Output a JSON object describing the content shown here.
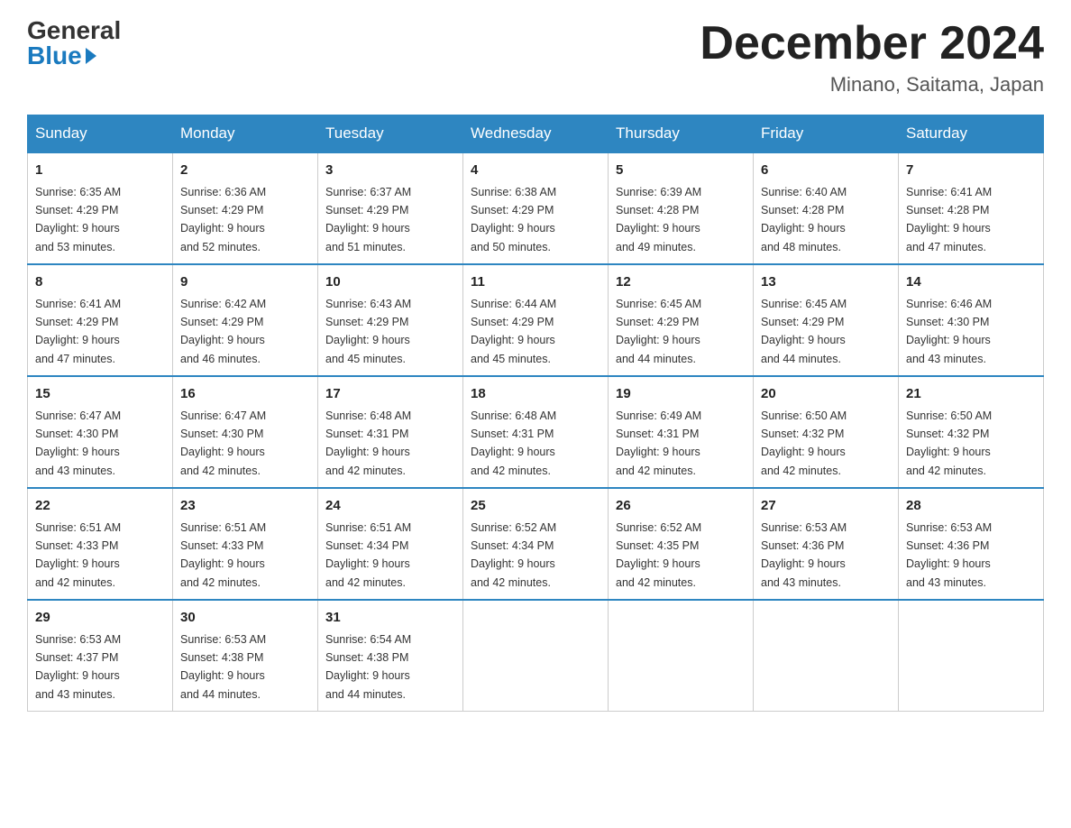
{
  "header": {
    "logo_general": "General",
    "logo_blue": "Blue",
    "month_title": "December 2024",
    "location": "Minano, Saitama, Japan"
  },
  "days_of_week": [
    "Sunday",
    "Monday",
    "Tuesday",
    "Wednesday",
    "Thursday",
    "Friday",
    "Saturday"
  ],
  "weeks": [
    [
      {
        "day": "1",
        "sunrise": "6:35 AM",
        "sunset": "4:29 PM",
        "daylight": "9 hours and 53 minutes."
      },
      {
        "day": "2",
        "sunrise": "6:36 AM",
        "sunset": "4:29 PM",
        "daylight": "9 hours and 52 minutes."
      },
      {
        "day": "3",
        "sunrise": "6:37 AM",
        "sunset": "4:29 PM",
        "daylight": "9 hours and 51 minutes."
      },
      {
        "day": "4",
        "sunrise": "6:38 AM",
        "sunset": "4:29 PM",
        "daylight": "9 hours and 50 minutes."
      },
      {
        "day": "5",
        "sunrise": "6:39 AM",
        "sunset": "4:28 PM",
        "daylight": "9 hours and 49 minutes."
      },
      {
        "day": "6",
        "sunrise": "6:40 AM",
        "sunset": "4:28 PM",
        "daylight": "9 hours and 48 minutes."
      },
      {
        "day": "7",
        "sunrise": "6:41 AM",
        "sunset": "4:28 PM",
        "daylight": "9 hours and 47 minutes."
      }
    ],
    [
      {
        "day": "8",
        "sunrise": "6:41 AM",
        "sunset": "4:29 PM",
        "daylight": "9 hours and 47 minutes."
      },
      {
        "day": "9",
        "sunrise": "6:42 AM",
        "sunset": "4:29 PM",
        "daylight": "9 hours and 46 minutes."
      },
      {
        "day": "10",
        "sunrise": "6:43 AM",
        "sunset": "4:29 PM",
        "daylight": "9 hours and 45 minutes."
      },
      {
        "day": "11",
        "sunrise": "6:44 AM",
        "sunset": "4:29 PM",
        "daylight": "9 hours and 45 minutes."
      },
      {
        "day": "12",
        "sunrise": "6:45 AM",
        "sunset": "4:29 PM",
        "daylight": "9 hours and 44 minutes."
      },
      {
        "day": "13",
        "sunrise": "6:45 AM",
        "sunset": "4:29 PM",
        "daylight": "9 hours and 44 minutes."
      },
      {
        "day": "14",
        "sunrise": "6:46 AM",
        "sunset": "4:30 PM",
        "daylight": "9 hours and 43 minutes."
      }
    ],
    [
      {
        "day": "15",
        "sunrise": "6:47 AM",
        "sunset": "4:30 PM",
        "daylight": "9 hours and 43 minutes."
      },
      {
        "day": "16",
        "sunrise": "6:47 AM",
        "sunset": "4:30 PM",
        "daylight": "9 hours and 42 minutes."
      },
      {
        "day": "17",
        "sunrise": "6:48 AM",
        "sunset": "4:31 PM",
        "daylight": "9 hours and 42 minutes."
      },
      {
        "day": "18",
        "sunrise": "6:48 AM",
        "sunset": "4:31 PM",
        "daylight": "9 hours and 42 minutes."
      },
      {
        "day": "19",
        "sunrise": "6:49 AM",
        "sunset": "4:31 PM",
        "daylight": "9 hours and 42 minutes."
      },
      {
        "day": "20",
        "sunrise": "6:50 AM",
        "sunset": "4:32 PM",
        "daylight": "9 hours and 42 minutes."
      },
      {
        "day": "21",
        "sunrise": "6:50 AM",
        "sunset": "4:32 PM",
        "daylight": "9 hours and 42 minutes."
      }
    ],
    [
      {
        "day": "22",
        "sunrise": "6:51 AM",
        "sunset": "4:33 PM",
        "daylight": "9 hours and 42 minutes."
      },
      {
        "day": "23",
        "sunrise": "6:51 AM",
        "sunset": "4:33 PM",
        "daylight": "9 hours and 42 minutes."
      },
      {
        "day": "24",
        "sunrise": "6:51 AM",
        "sunset": "4:34 PM",
        "daylight": "9 hours and 42 minutes."
      },
      {
        "day": "25",
        "sunrise": "6:52 AM",
        "sunset": "4:34 PM",
        "daylight": "9 hours and 42 minutes."
      },
      {
        "day": "26",
        "sunrise": "6:52 AM",
        "sunset": "4:35 PM",
        "daylight": "9 hours and 42 minutes."
      },
      {
        "day": "27",
        "sunrise": "6:53 AM",
        "sunset": "4:36 PM",
        "daylight": "9 hours and 43 minutes."
      },
      {
        "day": "28",
        "sunrise": "6:53 AM",
        "sunset": "4:36 PM",
        "daylight": "9 hours and 43 minutes."
      }
    ],
    [
      {
        "day": "29",
        "sunrise": "6:53 AM",
        "sunset": "4:37 PM",
        "daylight": "9 hours and 43 minutes."
      },
      {
        "day": "30",
        "sunrise": "6:53 AM",
        "sunset": "4:38 PM",
        "daylight": "9 hours and 44 minutes."
      },
      {
        "day": "31",
        "sunrise": "6:54 AM",
        "sunset": "4:38 PM",
        "daylight": "9 hours and 44 minutes."
      },
      null,
      null,
      null,
      null
    ]
  ],
  "labels": {
    "sunrise": "Sunrise:",
    "sunset": "Sunset:",
    "daylight": "Daylight:"
  }
}
